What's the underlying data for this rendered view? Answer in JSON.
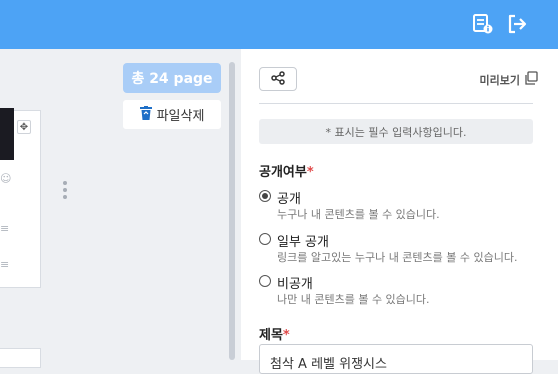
{
  "header": {
    "notes_icon": "document-info-icon",
    "logout_icon": "logout-icon",
    "bg_color": "#4da3f5"
  },
  "left_panel": {
    "page_count_label": "총 24 page",
    "delete_files_label": "파일삭제",
    "trash_icon": "trash-icon"
  },
  "right_panel": {
    "share_icon": "share-icon",
    "preview_label": "미리보기",
    "copy_icon": "copy-icon",
    "required_notice": "* 표시는 필수 입력사항입니다.",
    "visibility": {
      "label": "공개여부",
      "required_mark": "*",
      "options": [
        {
          "title": "공개",
          "desc": "누구나 내 콘텐츠를 볼 수 있습니다.",
          "checked": true
        },
        {
          "title": "일부 공개",
          "desc": "링크를 알고있는 누구나 내 콘텐츠를 볼 수 있습니다.",
          "checked": false
        },
        {
          "title": "비공개",
          "desc": "나만 내 콘텐츠를 볼 수 있습니다.",
          "checked": false
        }
      ]
    },
    "title_field": {
      "label": "제목",
      "required_mark": "*",
      "value": "첨삭 A 레벨 위쟁시스"
    }
  }
}
